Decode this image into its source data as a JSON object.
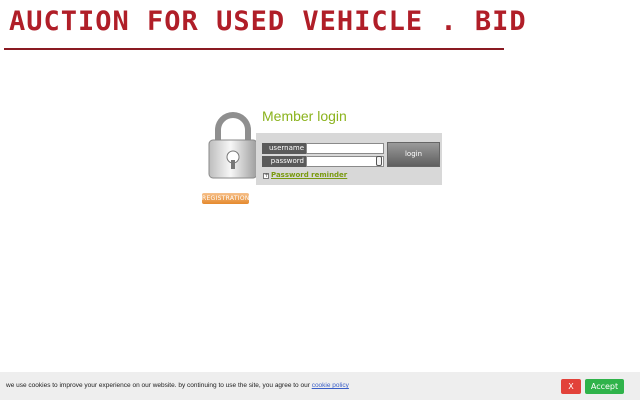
{
  "header": {
    "title": "AUCTION FOR USED VEHICLE . BID"
  },
  "login": {
    "heading": "Member login",
    "username_label": "username",
    "password_label": "password",
    "username_value": "",
    "password_value": "",
    "login_button": "login",
    "reminder_link": "Password reminder",
    "registration_button": "REGISTRATION"
  },
  "cookie": {
    "text": "we use cookies to improve your experience on our website. by continuing to use the site, you agree to our ",
    "link": "cookie policy",
    "decline_label": "X",
    "accept_label": "Accept"
  },
  "colors": {
    "title": "#b01e28",
    "heading": "#8bb31d",
    "accept": "#2fb34a",
    "decline": "#e2423a"
  },
  "icons": [
    "padlock-icon",
    "reminder-icon",
    "password-key-icon"
  ]
}
